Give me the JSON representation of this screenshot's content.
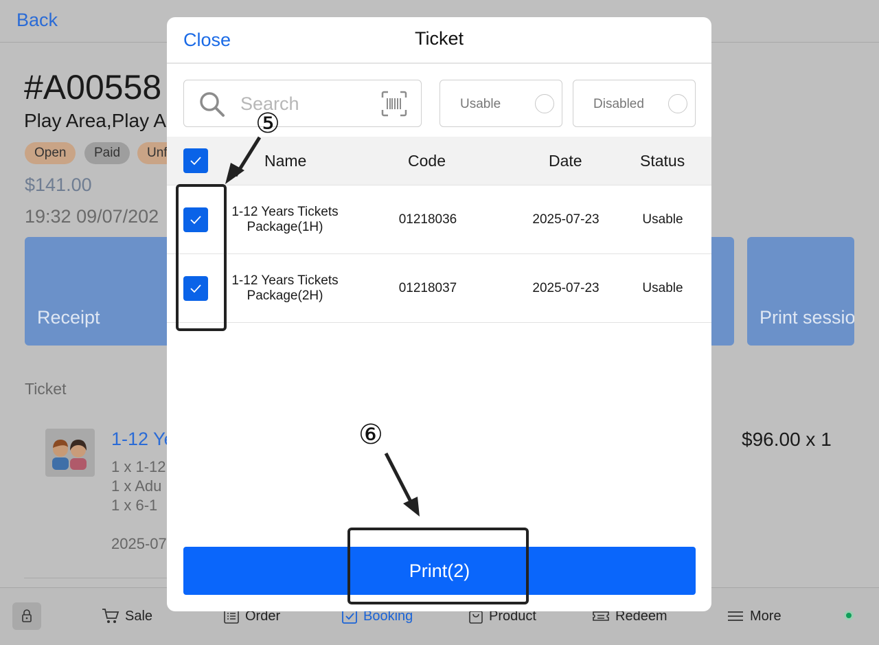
{
  "background": {
    "back_label": "Back",
    "order_no": "#A00558",
    "areas": "Play Area,Play A",
    "badges": [
      "Open",
      "Paid",
      "Unf"
    ],
    "amount": "$141.00",
    "time": "19:32 09/07/202",
    "tiles": [
      "Receipt",
      "Print sessio"
    ],
    "ticket_section": "Ticket",
    "item": {
      "name": "1-12 Ye",
      "lines": [
        "1 x   1-12",
        "1 x   Adu",
        "1 x   6-1"
      ],
      "date": "2025-07",
      "price": "$96.00 x 1"
    }
  },
  "tabbar": {
    "tabs": [
      {
        "label": "Sale",
        "icon": "cart-icon"
      },
      {
        "label": "Order",
        "icon": "list-icon"
      },
      {
        "label": "Booking",
        "icon": "booking-check-icon",
        "active": true
      },
      {
        "label": "Product",
        "icon": "bag-icon"
      },
      {
        "label": "Redeem",
        "icon": "ticket-icon"
      },
      {
        "label": "More",
        "icon": "menu-icon"
      }
    ],
    "status_color": "#0f9f5a"
  },
  "modal": {
    "close_label": "Close",
    "title": "Ticket",
    "search_placeholder": "Search",
    "filters": [
      "Usable",
      "Disabled"
    ],
    "columns": [
      "Name",
      "Code",
      "Date",
      "Status"
    ],
    "rows": [
      {
        "name_line1": "1-12 Years Tickets",
        "name_line2": "Package(1H)",
        "code": "01218036",
        "date": "2025-07-23",
        "status": "Usable",
        "checked": true
      },
      {
        "name_line1": "1-12 Years Tickets",
        "name_line2": "Package(2H)",
        "code": "01218037",
        "date": "2025-07-23",
        "status": "Usable",
        "checked": true
      }
    ],
    "print_label": "Print(2)",
    "accent": "#0a66fb"
  },
  "annotations": {
    "step5": "⑤",
    "step6": "⑥"
  }
}
